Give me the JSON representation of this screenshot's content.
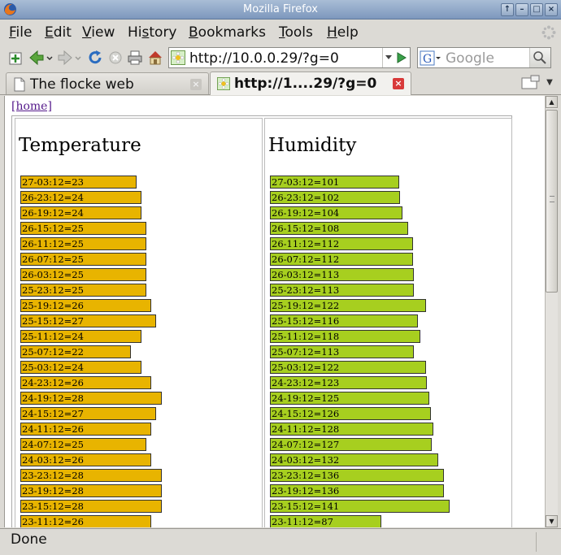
{
  "window": {
    "title": "Mozilla Firefox"
  },
  "menubar": {
    "items": [
      {
        "label": "File",
        "mnemonic": "F",
        "rest": "ile"
      },
      {
        "label": "Edit",
        "mnemonic": "E",
        "rest": "dit"
      },
      {
        "label": "View",
        "mnemonic": "V",
        "rest": "iew"
      },
      {
        "label": "History",
        "pre": "Hi",
        "mnemonic": "s",
        "rest": "tory"
      },
      {
        "label": "Bookmarks",
        "mnemonic": "B",
        "rest": "ookmarks"
      },
      {
        "label": "Tools",
        "mnemonic": "T",
        "rest": "ools"
      },
      {
        "label": "Help",
        "mnemonic": "H",
        "rest": "elp"
      }
    ]
  },
  "navbar": {
    "url": "http://10.0.0.29/?g=0",
    "search_placeholder": "Google",
    "icons": [
      "new-tab-icon",
      "back-icon",
      "forward-icon",
      "reload-icon",
      "stop-icon",
      "print-icon",
      "home-icon"
    ]
  },
  "tabs": [
    {
      "label": "The flocke web",
      "active": false
    },
    {
      "label": "http://1....29/?g=0",
      "active": true
    }
  ],
  "page": {
    "home_link": "[home]",
    "temperature": {
      "heading": "Temperature",
      "color": "#e8b400",
      "rows": [
        {
          "label": "27-03:12=23",
          "value": 23
        },
        {
          "label": "26-23:12=24",
          "value": 24
        },
        {
          "label": "26-19:12=24",
          "value": 24
        },
        {
          "label": "26-15:12=25",
          "value": 25
        },
        {
          "label": "26-11:12=25",
          "value": 25
        },
        {
          "label": "26-07:12=25",
          "value": 25
        },
        {
          "label": "26-03:12=25",
          "value": 25
        },
        {
          "label": "25-23:12=25",
          "value": 25
        },
        {
          "label": "25-19:12=26",
          "value": 26
        },
        {
          "label": "25-15:12=27",
          "value": 27
        },
        {
          "label": "25-11:12=24",
          "value": 24
        },
        {
          "label": "25-07:12=22",
          "value": 22
        },
        {
          "label": "25-03:12=24",
          "value": 24
        },
        {
          "label": "24-23:12=26",
          "value": 26
        },
        {
          "label": "24-19:12=28",
          "value": 28
        },
        {
          "label": "24-15:12=27",
          "value": 27
        },
        {
          "label": "24-11:12=26",
          "value": 26
        },
        {
          "label": "24-07:12=25",
          "value": 25
        },
        {
          "label": "24-03:12=26",
          "value": 26
        },
        {
          "label": "23-23:12=28",
          "value": 28
        },
        {
          "label": "23-19:12=28",
          "value": 28
        },
        {
          "label": "23-15:12=28",
          "value": 28
        },
        {
          "label": "23-11:12=26",
          "value": 26
        }
      ]
    },
    "humidity": {
      "heading": "Humidity",
      "color": "#a7cf1f",
      "rows": [
        {
          "label": "27-03:12=101",
          "value": 101
        },
        {
          "label": "26-23:12=102",
          "value": 102
        },
        {
          "label": "26-19:12=104",
          "value": 104
        },
        {
          "label": "26-15:12=108",
          "value": 108
        },
        {
          "label": "26-11:12=112",
          "value": 112
        },
        {
          "label": "26-07:12=112",
          "value": 112
        },
        {
          "label": "26-03:12=113",
          "value": 113
        },
        {
          "label": "25-23:12=113",
          "value": 113
        },
        {
          "label": "25-19:12=122",
          "value": 122
        },
        {
          "label": "25-15:12=116",
          "value": 116
        },
        {
          "label": "25-11:12=118",
          "value": 118
        },
        {
          "label": "25-07:12=113",
          "value": 113
        },
        {
          "label": "25-03:12=122",
          "value": 122
        },
        {
          "label": "24-23:12=123",
          "value": 123
        },
        {
          "label": "24-19:12=125",
          "value": 125
        },
        {
          "label": "24-15:12=126",
          "value": 126
        },
        {
          "label": "24-11:12=128",
          "value": 128
        },
        {
          "label": "24-07:12=127",
          "value": 127
        },
        {
          "label": "24-03:12=132",
          "value": 132
        },
        {
          "label": "23-23:12=136",
          "value": 136
        },
        {
          "label": "23-19:12=136",
          "value": 136
        },
        {
          "label": "23-15:12=141",
          "value": 141
        },
        {
          "label": "23-11:12=87",
          "value": 87
        }
      ]
    }
  },
  "statusbar": {
    "text": "Done"
  }
}
